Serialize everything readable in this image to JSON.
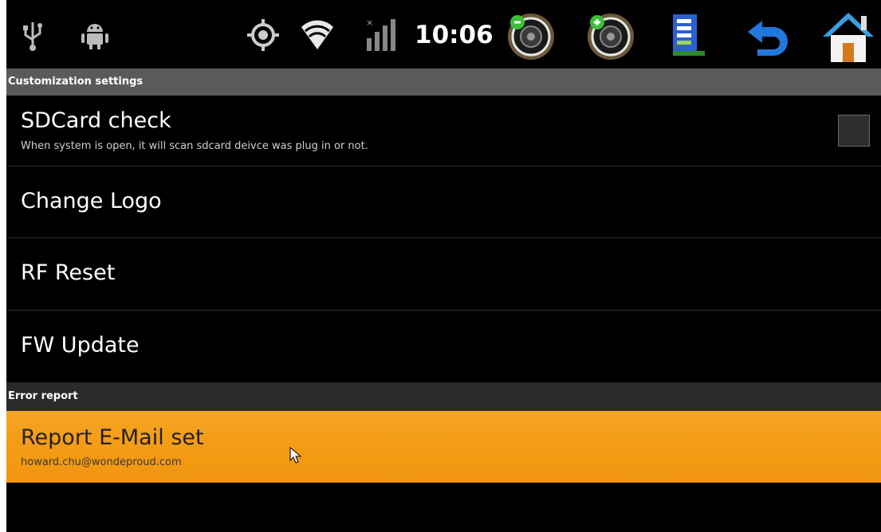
{
  "status_bar": {
    "time": "10:06",
    "icons": [
      "usb-icon",
      "android-debug-icon",
      "gps-icon",
      "wifi-icon",
      "signal-icon",
      "volume-down-icon",
      "volume-up-icon",
      "menu-icon",
      "back-icon",
      "home-icon"
    ]
  },
  "sections": {
    "customization": "Customization settings",
    "error_report": "Error report"
  },
  "items": {
    "sdcard": {
      "title": "SDCard check",
      "summary": "When system is open, it will scan sdcard deivce was plug in or not.",
      "checked": false
    },
    "change_logo": {
      "title": "Change Logo"
    },
    "rf_reset": {
      "title": "RF Reset"
    },
    "fw_update": {
      "title": "FW Update"
    },
    "report_email": {
      "title": "Report E-Mail set",
      "summary": "howard.chu@wondeproud.com"
    }
  },
  "colors": {
    "selected_row": "#f39a12",
    "section_header": "#5a5a5a",
    "background": "#000000"
  }
}
